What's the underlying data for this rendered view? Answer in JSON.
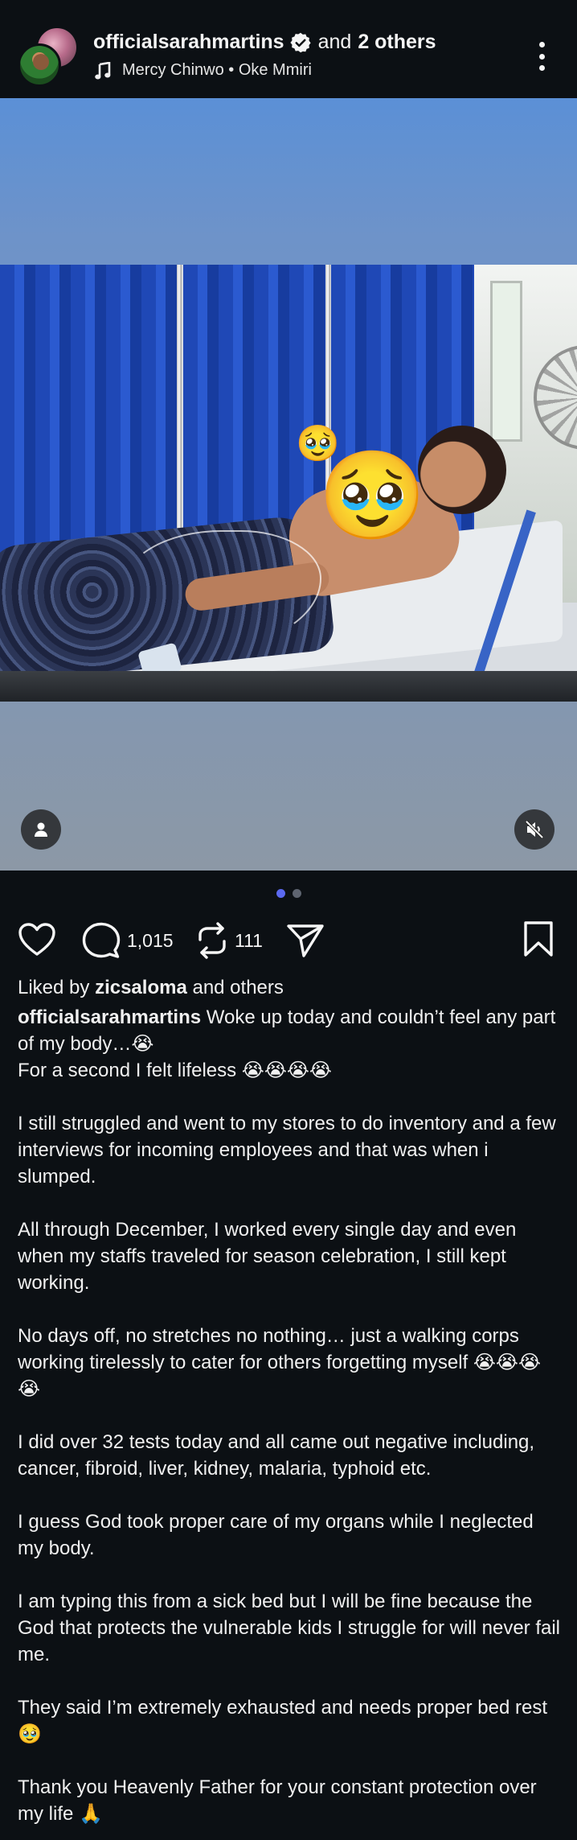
{
  "header": {
    "username": "officialsarahmartins",
    "and_text": "and",
    "others_text": "2 others",
    "music": "Mercy Chinwo • Oke Mmiri"
  },
  "icons": {
    "verified": "verified-badge-icon",
    "music": "music-note-icon",
    "more": "more-vertical-icon",
    "tag": "person-tag-icon",
    "mute": "speaker-muted-icon",
    "like": "heart-icon",
    "comment": "comment-bubble-icon",
    "repost": "repost-icon",
    "share": "send-icon",
    "save": "bookmark-icon"
  },
  "media": {
    "emoji_small": "🥹",
    "emoji_big": "🥹",
    "pages": 2,
    "active_page": 1
  },
  "actions": {
    "comments": "1,015",
    "reposts": "111"
  },
  "liked_by": {
    "prefix": "Liked by",
    "user": "zicsaloma",
    "suffix": "and others"
  },
  "caption": {
    "username": "officialsarahmartins",
    "line1": "Woke up today and couldn’t feel any part of my body…😭",
    "line2": "For a second I felt lifeless 😭😭😭😭",
    "p2": "I still struggled and went to my stores to do inventory and a few interviews for incoming employees and that was when i slumped.",
    "p3": "All through December, I worked every single day and even when my staffs traveled for season celebration, I still kept working.",
    "p4": "No days off, no stretches no nothing… just a walking corps working tirelessly to cater for others forgetting myself 😭😭😭😭",
    "p5": "I did over 32 tests today and all came out negative including, cancer, fibroid, liver, kidney, malaria, typhoid etc.",
    "p6": "I guess God took proper care of my organs while I neglected my body.",
    "p7": "I am typing this from a sick bed but I will be fine because the God that protects the vulnerable kids I struggle for will never fail me.",
    "p8": "They said I’m extremely exhausted and needs proper bed rest 🥹",
    "p9": "Thank you Heavenly Father for your constant protection over my life 🙏"
  }
}
